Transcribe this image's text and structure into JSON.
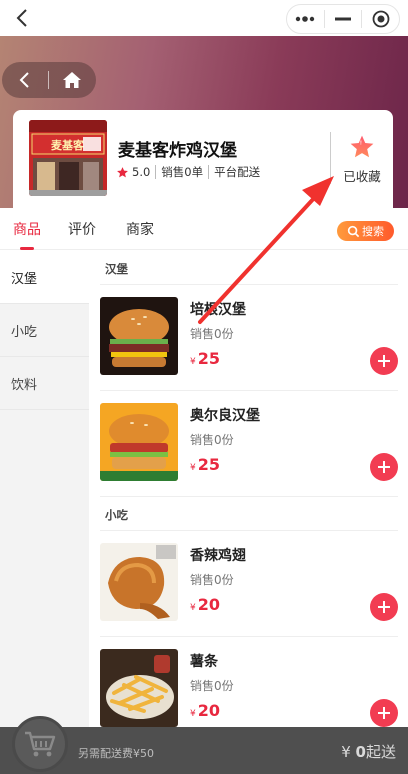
{
  "shop": {
    "name": "麦基客炸鸡汉堡",
    "sign_text": "麦基客",
    "rating": "5.0",
    "sales": "销售0单",
    "delivery_mode": "平台配送",
    "favorite_label": "已收藏"
  },
  "tabs": [
    {
      "label": "商品",
      "active": true
    },
    {
      "label": "评价",
      "active": false
    },
    {
      "label": "商家",
      "active": false
    }
  ],
  "search_label": "搜索",
  "categories": [
    {
      "label": "汉堡",
      "active": true
    },
    {
      "label": "小吃",
      "active": false
    },
    {
      "label": "饮料",
      "active": false
    }
  ],
  "sections": [
    {
      "title": "汉堡",
      "items": [
        {
          "name": "培根汉堡",
          "sales": "销售0份",
          "currency": "¥",
          "price": "25",
          "image": "burger-bacon"
        },
        {
          "name": "奥尔良汉堡",
          "sales": "销售0份",
          "currency": "¥",
          "price": "25",
          "image": "burger-orleans"
        }
      ]
    },
    {
      "title": "小吃",
      "items": [
        {
          "name": "香辣鸡翅",
          "sales": "销售0份",
          "currency": "¥",
          "price": "20",
          "image": "chicken-wing"
        },
        {
          "name": "薯条",
          "sales": "销售0份",
          "currency": "¥",
          "price": "20",
          "image": "french-fries"
        }
      ]
    }
  ],
  "cart": {
    "delivery_fee_text": "另需配送费¥50",
    "currency": "¥",
    "amount": "0",
    "suffix": "起送"
  },
  "colors": {
    "accent": "#e8283f",
    "add_button": "#f23c52",
    "bottom_bar": "#4f4f4f"
  }
}
